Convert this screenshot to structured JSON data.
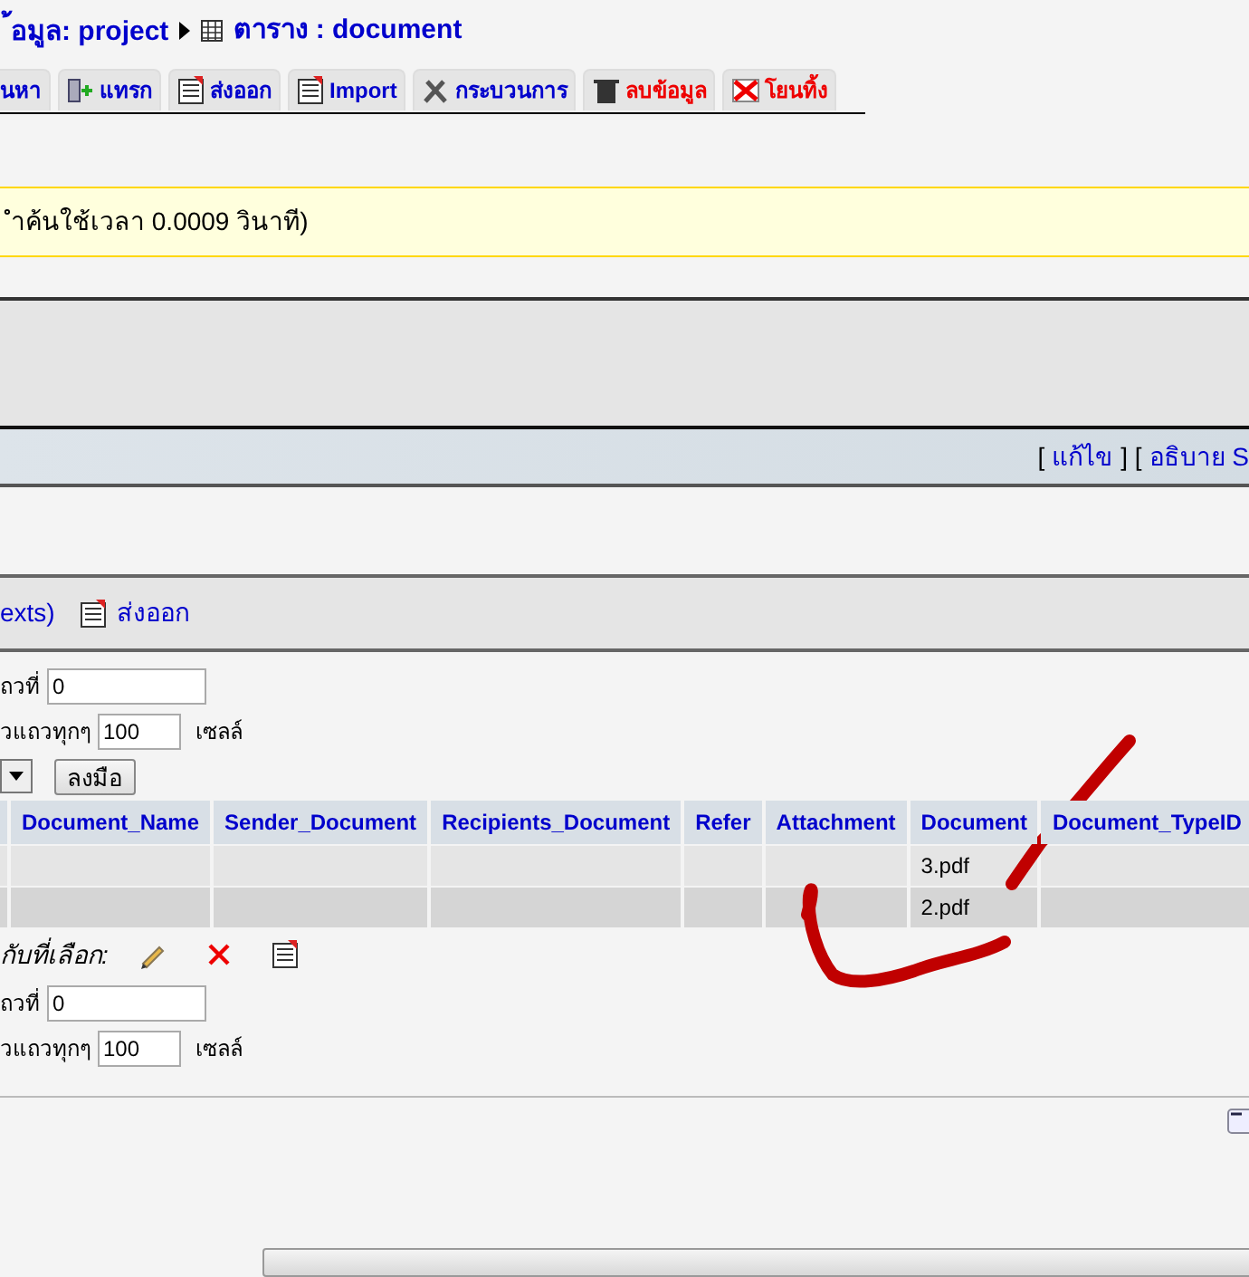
{
  "breadcrumb": {
    "database_part": "้อมูล: project",
    "table_label": "ตาราง : document"
  },
  "tabs": [
    {
      "label": "นหา",
      "kind": "plain"
    },
    {
      "label": "แทรก",
      "kind": "plain"
    },
    {
      "label": "ส่งออก",
      "kind": "plain"
    },
    {
      "label": "Import",
      "kind": "plain"
    },
    {
      "label": "กระบวนการ",
      "kind": "plain"
    },
    {
      "label": "ลบข้อมูล",
      "kind": "danger"
    },
    {
      "label": "โยนทิ้ง",
      "kind": "danger"
    }
  ],
  "notice": "ำค้นใช้เวลา 0.0009 วินาที)",
  "sql_links": [
    {
      "text": "[",
      "kind": "punct"
    },
    {
      "text": "แก้ไข",
      "kind": "link"
    },
    {
      "text": "] [",
      "kind": "punct"
    },
    {
      "text": "อธิบาย S",
      "kind": "link"
    }
  ],
  "query_bar": [
    {
      "text": "exts)",
      "kind": "link"
    },
    {
      "text": "ส่งออก",
      "kind": "export"
    }
  ],
  "nav_top": {
    "start_label": "ถวที่",
    "start_value": "0",
    "repeat_label": "วแถวทุกๆ",
    "repeat_value": "100",
    "repeat_suffix": "เซลล์",
    "go_button": "ลงมือ"
  },
  "table": {
    "columns": [
      "Document_Name",
      "Sender_Document",
      "Recipients_Document",
      "Refer",
      "Attachment",
      "Document",
      "Document_TypeID"
    ],
    "rows": [
      {
        "cells": [
          null,
          null,
          null,
          null,
          null,
          "3.pdf",
          null
        ]
      },
      {
        "cells": [
          null,
          null,
          null,
          null,
          null,
          "2.pdf",
          null
        ]
      }
    ]
  },
  "with_selected": {
    "label": "กับที่เลือก:"
  },
  "nav_bottom": {
    "start_label": "ถวที่",
    "start_value": "0",
    "repeat_label": "วแถวทุกๆ",
    "repeat_value": "100",
    "repeat_suffix": "เซลล์"
  }
}
